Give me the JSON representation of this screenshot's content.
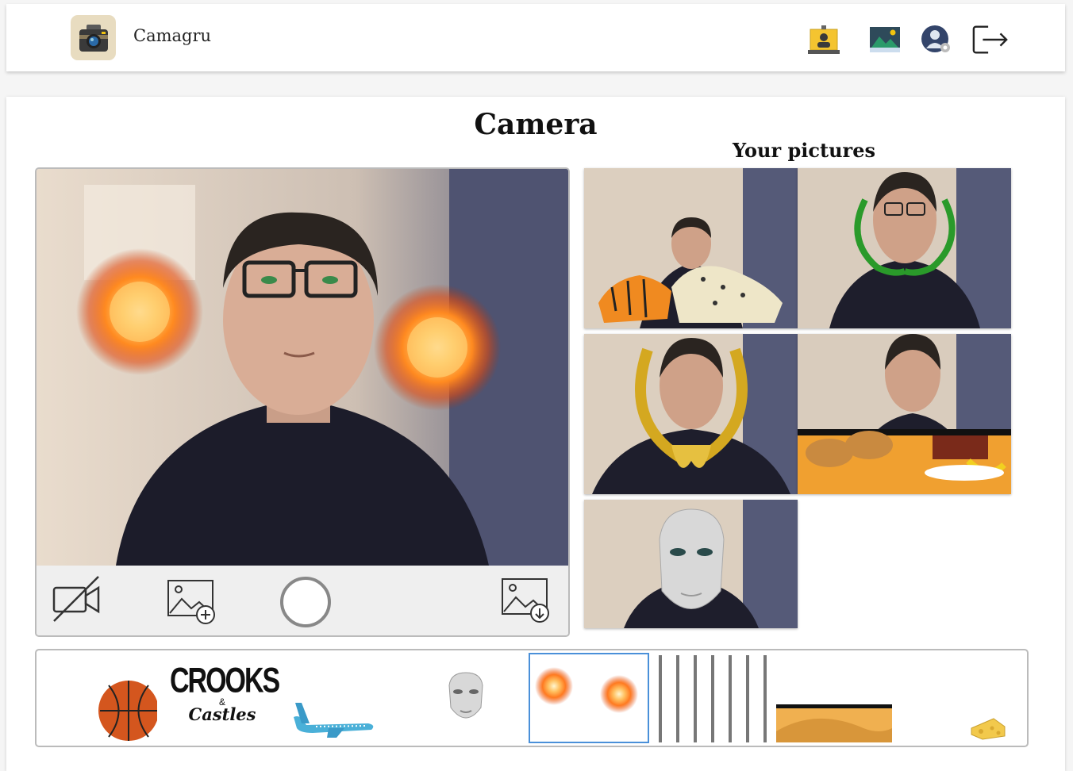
{
  "app": {
    "name": "Camagru"
  },
  "nav": {
    "icons": [
      "webcam-icon",
      "gallery-icon",
      "account-settings-icon",
      "logout-icon"
    ]
  },
  "page": {
    "title": "Camera",
    "pictures_heading": "Your pictures"
  },
  "camera": {
    "controls": [
      "camera-off-icon",
      "upload-image-icon",
      "capture-icon",
      "download-image-icon"
    ]
  },
  "stickers": {
    "items": [
      "basketball",
      "crooks-and-castles-logo",
      "airplane",
      "mask",
      "fireballs",
      "bars",
      "desert",
      "cheese"
    ],
    "selected": "fireballs",
    "crooks_top": "CROOKS",
    "crooks_mid": "&",
    "crooks_bottom": "Castles"
  },
  "colors": {
    "accent": "#4a90d9",
    "border": "#bbbbbb"
  }
}
